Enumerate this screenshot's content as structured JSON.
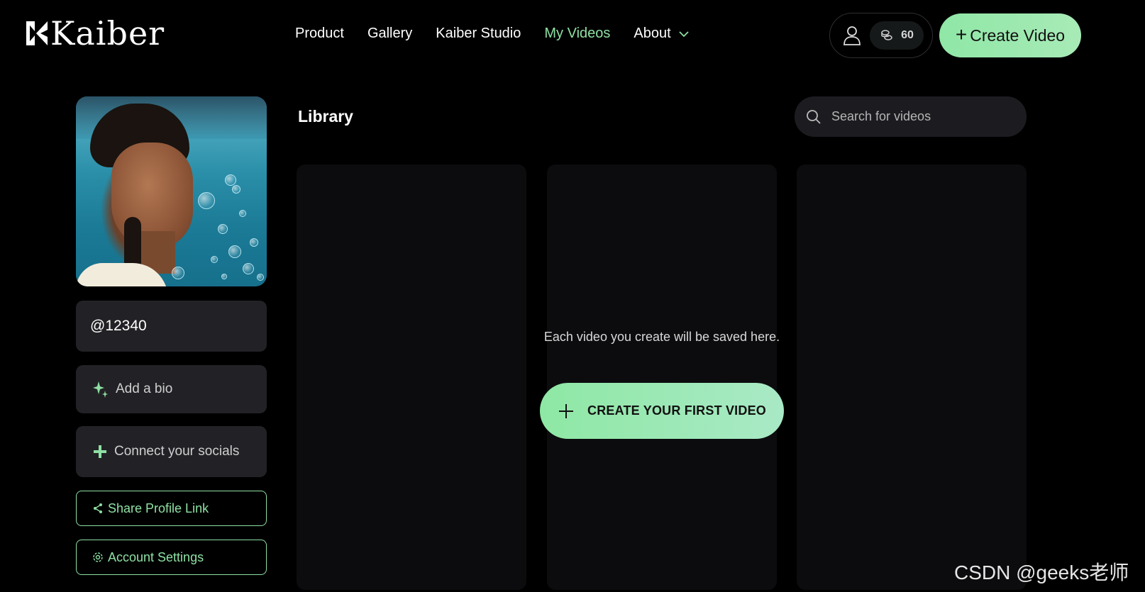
{
  "brand": {
    "name": "Kaiber"
  },
  "nav": {
    "items": [
      {
        "label": "Product"
      },
      {
        "label": "Gallery"
      },
      {
        "label": "Kaiber Studio"
      },
      {
        "label": "My Videos",
        "active": true
      },
      {
        "label": "About"
      }
    ]
  },
  "account": {
    "credits": "60"
  },
  "header": {
    "create_button": "Create Video"
  },
  "profile": {
    "username": "@12340",
    "add_bio": "Add a bio",
    "connect_socials": "Connect your socials",
    "share_link": "Share Profile Link",
    "account_settings": "Account Settings"
  },
  "library": {
    "title": "Library",
    "search_placeholder": "Search for videos",
    "empty_message": "Each video you create will be saved here.",
    "first_video_button": "CREATE YOUR FIRST VIDEO"
  },
  "watermark": "CSDN @geeks老师",
  "colors": {
    "accent": "#8ee0a3",
    "background": "#000000",
    "card": "#222226"
  }
}
